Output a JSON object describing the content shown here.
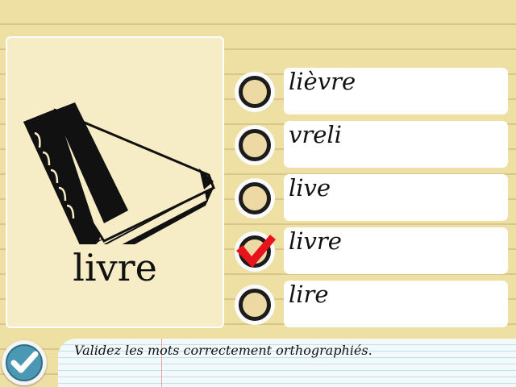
{
  "card": {
    "image_icon": "book-icon",
    "word": "livre"
  },
  "options": [
    {
      "label": "lièvre",
      "checked": false
    },
    {
      "label": "vreli",
      "checked": false
    },
    {
      "label": "live",
      "checked": false
    },
    {
      "label": "livre",
      "checked": true
    },
    {
      "label": "lire",
      "checked": false
    }
  ],
  "instruction": "Validez les mots correctement orthographiés.",
  "validate_button": {
    "icon": "checkmark-icon"
  },
  "colors": {
    "background": "#eedfa2",
    "card": "#f6ecc6",
    "check": "#e8141c",
    "validate": "#4a98b3"
  }
}
